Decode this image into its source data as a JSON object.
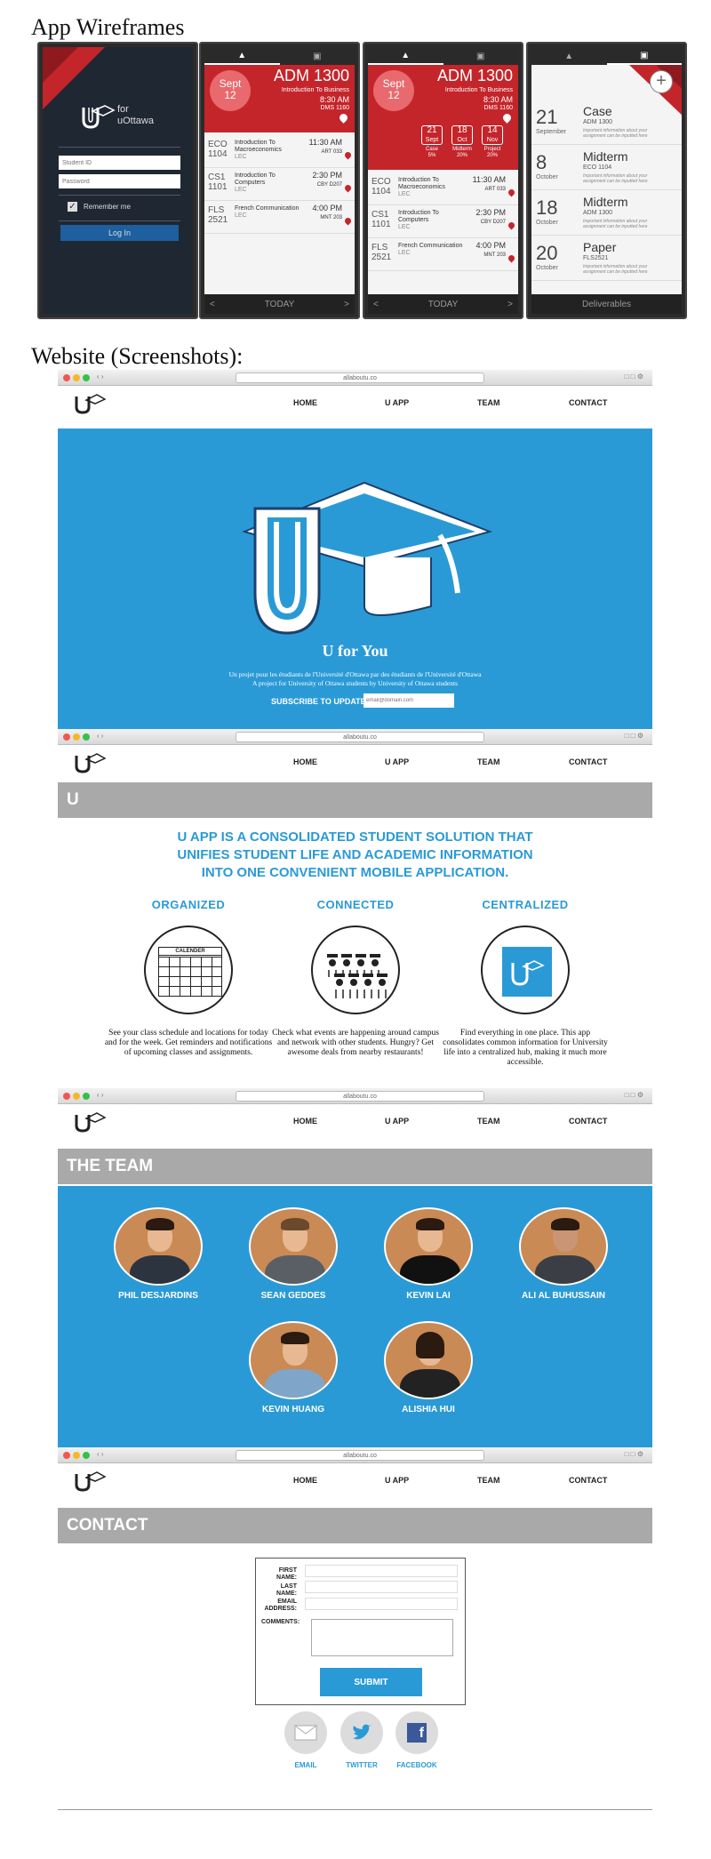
{
  "titles": {
    "wireframes": "App Wireframes",
    "website": "Website (Screenshots):"
  },
  "login": {
    "brand_for": "for",
    "brand_name": "uOttawa",
    "student_id_placeholder": "Student ID",
    "password_placeholder": "Password",
    "remember": "Remember me",
    "login_button": "Log In"
  },
  "today1": {
    "date_month": "Sept",
    "date_day": "12",
    "course": "ADM 1300",
    "course_name": "Introduction To Business",
    "time": "8:30 AM",
    "room": "DMS 1160",
    "rows": [
      {
        "code": "ECO",
        "num": "1104",
        "name": "Introduction To Macroeconomics",
        "type": "LEC",
        "time": "11:30 AM",
        "room": "ART 033"
      },
      {
        "code": "CS1",
        "num": "1101",
        "name": "Introduction To Computers",
        "type": "LEC",
        "time": "2:30 PM",
        "room": "CBY D207"
      },
      {
        "code": "FLS",
        "num": "2521",
        "name": "French Communication",
        "type": "LEC",
        "time": "4:00 PM",
        "room": "MNT 203"
      }
    ],
    "bottom": "TODAY",
    "prev": "<",
    "next": ">"
  },
  "today2": {
    "date_month": "Sept",
    "date_day": "12",
    "course": "ADM 1300",
    "course_name": "Introduction To Business",
    "time": "8:30 AM",
    "room": "DMS 1160",
    "deliverables": [
      {
        "day": "21",
        "month": "Sept",
        "label": "Case",
        "pct": "5%"
      },
      {
        "day": "18",
        "month": "Oct",
        "label": "Midterm",
        "pct": "20%"
      },
      {
        "day": "14",
        "month": "Nov",
        "label": "Project",
        "pct": "20%"
      }
    ],
    "rows": [
      {
        "code": "ECO",
        "num": "1104",
        "name": "Introduction To Macroeconomics",
        "type": "LEC",
        "time": "11:30 AM",
        "room": "ART 033"
      },
      {
        "code": "CS1",
        "num": "1101",
        "name": "Introduction To Computers",
        "type": "LEC",
        "time": "2:30 PM",
        "room": "CBY D207"
      },
      {
        "code": "FLS",
        "num": "2521",
        "name": "French Communication",
        "type": "LEC",
        "time": "4:00 PM",
        "room": "MNT 203"
      }
    ],
    "bottom": "TODAY",
    "prev": "<",
    "next": ">"
  },
  "deliv": {
    "plus": "+",
    "items": [
      {
        "day": "21",
        "month": "September",
        "title": "Case",
        "course": "ADM 1300",
        "desc": "Important information about your assignment can be inputted here"
      },
      {
        "day": "8",
        "month": "October",
        "title": "Midterm",
        "course": "ECO 1104",
        "desc": "Important information about your assignment can be inputted here"
      },
      {
        "day": "18",
        "month": "October",
        "title": "Midterm",
        "course": "ADM 1300",
        "desc": "Important information about your assignment can be inputted here"
      },
      {
        "day": "20",
        "month": "October",
        "title": "Paper",
        "course": "FLS2521",
        "desc": "Important information about your assignment can be inputted here"
      }
    ],
    "bottom": "Deliverables"
  },
  "browser": {
    "url": "allaboutu.co"
  },
  "nav": {
    "home": "HOME",
    "uapp": "U APP",
    "team": "TEAM",
    "contact": "CONTACT"
  },
  "hero": {
    "title": "U for You",
    "line_fr": "Un projet pour les étudiants de l'Université d'Ottawa par des étudiants de l'Université d'Ottawa",
    "line_en": "A project for University of Ottawa students by University of Ottawa students",
    "subscribe_label": "SUBSCRIBE TO UPDATES:",
    "email_placeholder": "email@domain.com"
  },
  "uapp": {
    "bar_title": "U",
    "headline_1": "U APP IS A CONSOLIDATED STUDENT SOLUTION THAT",
    "headline_2": "UNIFIES STUDENT LIFE AND ACADEMIC INFORMATION",
    "headline_3": "INTO ONE CONVENIENT MOBILE APPLICATION.",
    "features": [
      {
        "title": "ORGANIZED",
        "desc": "See your class schedule and locations for today and for the week. Get reminders and notifications of upcoming classes and assignments.",
        "calendar_label": "CALENDER"
      },
      {
        "title": "CONNECTED",
        "desc": "Check what events are happening around campus and network with other students. Hungry? Get awesome deals from nearby restaurants!"
      },
      {
        "title": "CENTRALIZED",
        "desc": "Find everything in one place. This app consolidates common information for University life into a centralized hub, making it much more accessible."
      }
    ]
  },
  "team": {
    "bar_title": "THE TEAM",
    "members": [
      "PHIL DESJARDINS",
      "SEAN GEDDES",
      "KEVIN LAI",
      "ALI AL BUHUSSAIN",
      "KEVIN HUANG",
      "ALISHIA HUI"
    ]
  },
  "contact": {
    "bar_title": "CONTACT",
    "first_name": "FIRST NAME:",
    "last_name": "LAST NAME:",
    "email": "EMAIL ADDRESS:",
    "comments": "COMMENTS:",
    "submit": "SUBMIT",
    "social": [
      "EMAIL",
      "TWITTER",
      "FACEBOOK"
    ]
  },
  "colors": {
    "brand_blue": "#2a9ad6",
    "brand_red": "#c4252b",
    "gray_bar": "#a9a9a9"
  }
}
